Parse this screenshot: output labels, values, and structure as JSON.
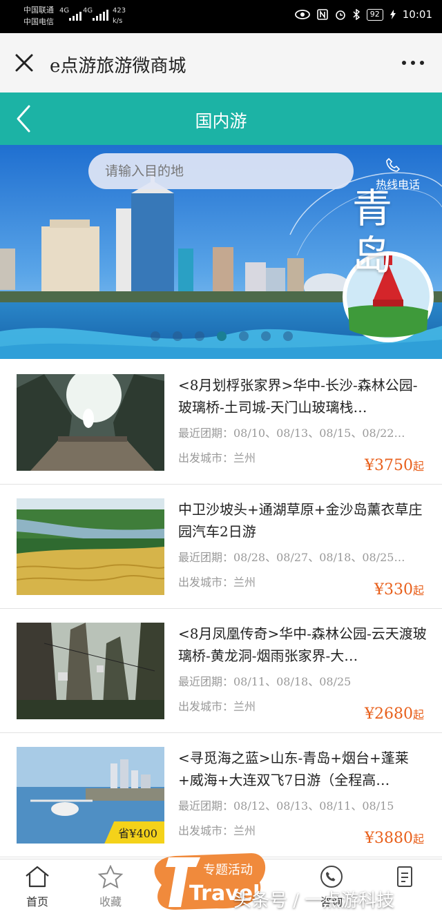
{
  "status_bar": {
    "carrier_1": "中国联通",
    "carrier_2": "中国电信",
    "net_1": "4G",
    "net_2": "4G",
    "speed": "423",
    "speed_unit": "k/s",
    "battery": "92",
    "time": "10:01"
  },
  "titlebar": {
    "title": "e点游旅游微商城"
  },
  "header": {
    "title": "国内游"
  },
  "banner": {
    "search_placeholder": "请输入目的地",
    "hotline_label": "热线电话",
    "city_label": "青岛",
    "slides": 7,
    "active_slide": 4
  },
  "products": [
    {
      "title": "<8月划桴张家界>华中-长沙-森林公园-玻璃桥-土司城-天门山玻璃栈…",
      "dates": "最近团期：08/10、08/13、08/15、08/22…",
      "city": "出发城市：兰州",
      "price": "¥3750",
      "price_suffix": "起"
    },
    {
      "title": "中卫沙坡头+通湖草原+金沙岛薰衣草庄园汽车2日游",
      "dates": "最近团期：08/28、08/27、08/18、08/25…",
      "city": "出发城市：兰州",
      "price": "¥330",
      "price_suffix": "起"
    },
    {
      "title": "<8月凤凰传奇>华中-森林公园-云天渡玻璃桥-黄龙洞-烟雨张家界-大…",
      "dates": "最近团期：08/11、08/18、08/25",
      "city": "出发城市：兰州",
      "price": "¥2680",
      "price_suffix": "起"
    },
    {
      "title": "<寻觅海之蓝>山东-青岛+烟台+蓬莱+威海+大连双飞7日游（全程高…",
      "dates": "最近团期：08/12、08/13、08/11、08/15",
      "city": "出发城市：兰州",
      "price": "¥3880",
      "price_suffix": "起",
      "promo": "省¥400"
    }
  ],
  "bottom_nav": {
    "home": "首页",
    "favorites": "收藏",
    "consult": "咨询"
  },
  "promo_fab": {
    "line1": "专题活动",
    "line2": "Travel"
  },
  "watermark": "头条号 / 一点游科技",
  "colors": {
    "teal": "#1cb3a5",
    "price": "#e8601c",
    "promo": "#f4d21a"
  }
}
